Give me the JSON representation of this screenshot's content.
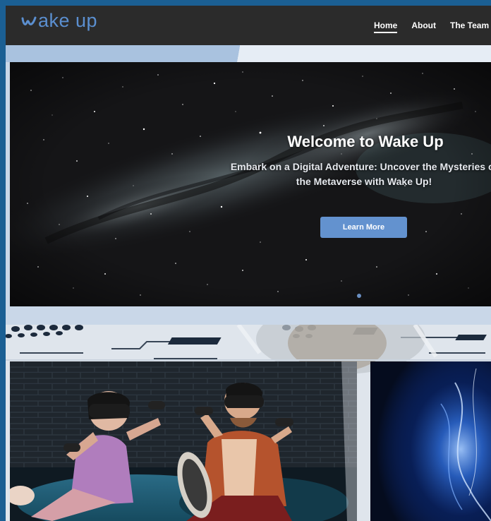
{
  "brand": {
    "logo_text": "ake up",
    "logo_mark": "w-wave-logo",
    "accent_color": "#5b8fd0"
  },
  "nav": {
    "items": [
      {
        "label": "Home",
        "active": true
      },
      {
        "label": "About",
        "active": false
      },
      {
        "label": "The Team",
        "active": false
      }
    ]
  },
  "hero": {
    "title": "Welcome to Wake Up",
    "subtitle": "Embark on a Digital Adventure: Uncover the Mysteries of the Metaverse with Wake Up!",
    "cta_label": "Learn More",
    "cta_color": "#6392cf",
    "carousel_dots": 1
  },
  "cards": [
    {
      "image": "vr-gamers-photo"
    },
    {
      "image": "blue-energy-photo"
    }
  ]
}
